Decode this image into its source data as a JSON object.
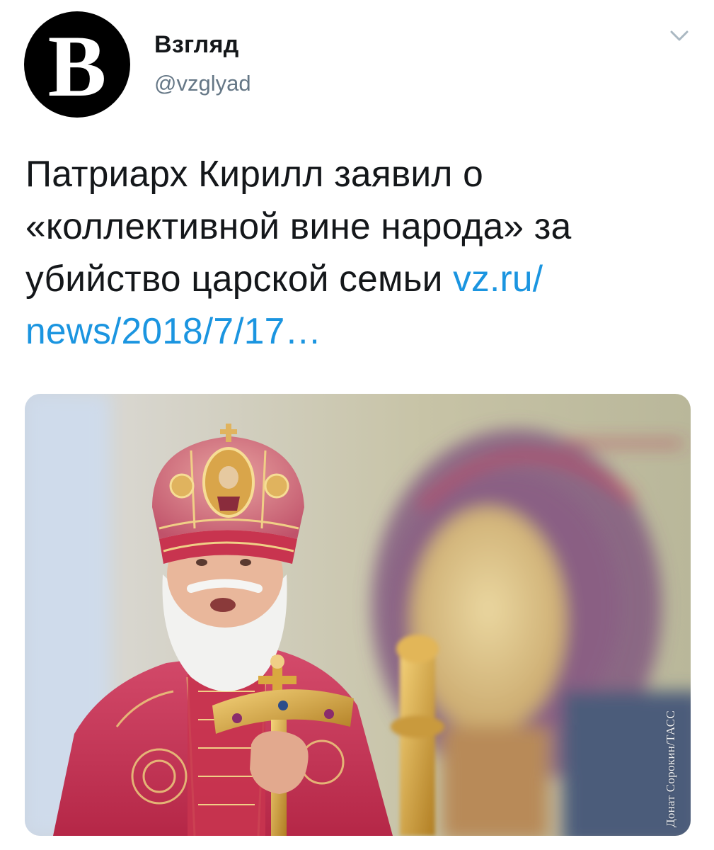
{
  "account": {
    "avatar_letter": "В",
    "display_name": "Взгляд",
    "handle": "@vzglyad"
  },
  "tweet": {
    "text": "Патриарх Кирилл заявил о\n«коллективной вине народа» за\nубийство царской семьи ",
    "link_part1": "vz.ru/",
    "link_part2": "news/2018/7/17…"
  },
  "media": {
    "photo_credit": "Донат Сорокин/ТАСС"
  },
  "icons": {
    "menu": "chevron-down-icon"
  },
  "colors": {
    "link": "#1b95e0",
    "handle": "#657786",
    "text": "#14171a",
    "avatar_bg": "#000000"
  }
}
